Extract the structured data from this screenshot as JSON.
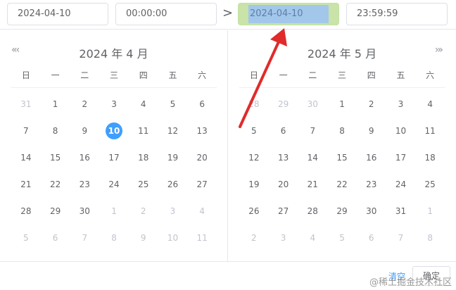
{
  "inputs": {
    "start_date": "2024-04-10",
    "start_time": "00:00:00",
    "end_date": "2024-04-10",
    "end_time": "23:59:59"
  },
  "separator": ">",
  "weekdays": [
    "日",
    "一",
    "二",
    "三",
    "四",
    "五",
    "六"
  ],
  "left": {
    "title": "2024 年 4 月",
    "nav": "«‹",
    "rows": [
      [
        {
          "t": "31",
          "m": true
        },
        {
          "t": "1"
        },
        {
          "t": "2"
        },
        {
          "t": "3"
        },
        {
          "t": "4"
        },
        {
          "t": "5"
        },
        {
          "t": "6"
        }
      ],
      [
        {
          "t": "7"
        },
        {
          "t": "8"
        },
        {
          "t": "9"
        },
        {
          "t": "10",
          "today": true
        },
        {
          "t": "11"
        },
        {
          "t": "12"
        },
        {
          "t": "13"
        }
      ],
      [
        {
          "t": "14"
        },
        {
          "t": "15"
        },
        {
          "t": "16"
        },
        {
          "t": "17"
        },
        {
          "t": "18"
        },
        {
          "t": "19"
        },
        {
          "t": "20"
        }
      ],
      [
        {
          "t": "21"
        },
        {
          "t": "22"
        },
        {
          "t": "23"
        },
        {
          "t": "24"
        },
        {
          "t": "25"
        },
        {
          "t": "26"
        },
        {
          "t": "27"
        }
      ],
      [
        {
          "t": "28"
        },
        {
          "t": "29"
        },
        {
          "t": "30"
        },
        {
          "t": "1",
          "m": true
        },
        {
          "t": "2",
          "m": true
        },
        {
          "t": "3",
          "m": true
        },
        {
          "t": "4",
          "m": true
        }
      ],
      [
        {
          "t": "5",
          "m": true
        },
        {
          "t": "6",
          "m": true
        },
        {
          "t": "7",
          "m": true
        },
        {
          "t": "8",
          "m": true
        },
        {
          "t": "9",
          "m": true
        },
        {
          "t": "10",
          "m": true
        },
        {
          "t": "11",
          "m": true
        }
      ]
    ]
  },
  "right": {
    "title": "2024 年 5 月",
    "nav": "›»",
    "rows": [
      [
        {
          "t": "28",
          "m": true
        },
        {
          "t": "29",
          "m": true
        },
        {
          "t": "30",
          "m": true
        },
        {
          "t": "1"
        },
        {
          "t": "2"
        },
        {
          "t": "3"
        },
        {
          "t": "4"
        }
      ],
      [
        {
          "t": "5"
        },
        {
          "t": "6"
        },
        {
          "t": "7"
        },
        {
          "t": "8"
        },
        {
          "t": "9"
        },
        {
          "t": "10"
        },
        {
          "t": "11"
        }
      ],
      [
        {
          "t": "12"
        },
        {
          "t": "13"
        },
        {
          "t": "14"
        },
        {
          "t": "15"
        },
        {
          "t": "16"
        },
        {
          "t": "17"
        },
        {
          "t": "18"
        }
      ],
      [
        {
          "t": "19"
        },
        {
          "t": "20"
        },
        {
          "t": "21"
        },
        {
          "t": "22"
        },
        {
          "t": "23"
        },
        {
          "t": "24"
        },
        {
          "t": "25"
        }
      ],
      [
        {
          "t": "26"
        },
        {
          "t": "27"
        },
        {
          "t": "28"
        },
        {
          "t": "29"
        },
        {
          "t": "30"
        },
        {
          "t": "31"
        },
        {
          "t": "1",
          "m": true
        }
      ],
      [
        {
          "t": "2",
          "m": true
        },
        {
          "t": "3",
          "m": true
        },
        {
          "t": "4",
          "m": true
        },
        {
          "t": "5",
          "m": true
        },
        {
          "t": "6",
          "m": true
        },
        {
          "t": "7",
          "m": true
        },
        {
          "t": "8",
          "m": true
        }
      ]
    ]
  },
  "footer": {
    "clear": "清空",
    "confirm": "确定"
  },
  "watermark": "@稀土掘金技术社区",
  "colors": {
    "accent": "#409eff",
    "arrow": "#e02b2b",
    "highlight": "#c9e3a8",
    "selection": "#a3c7ea"
  }
}
